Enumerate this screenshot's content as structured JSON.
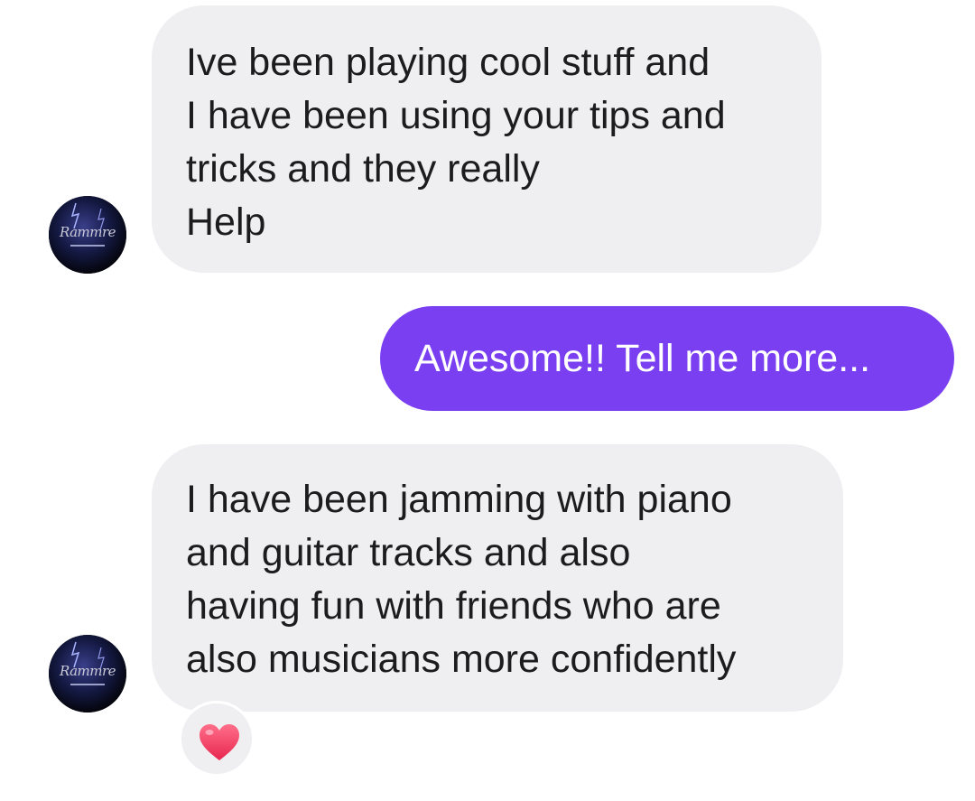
{
  "chat": {
    "messages": [
      {
        "direction": "incoming",
        "text": "Ive been playing cool stuff and\nI have been using your tips and\ntricks and they really\nHelp"
      },
      {
        "direction": "outgoing",
        "text": "Awesome!! Tell me more..."
      },
      {
        "direction": "incoming",
        "text": "I have been jamming with piano\nand guitar tracks and also\nhaving fun with friends who are\nalso musicians more confidently",
        "reaction": "heart-icon"
      }
    ],
    "avatar": {
      "logo_text": "Rammre"
    }
  },
  "colors": {
    "incoming_bubble": "#efeef1",
    "outgoing_bubble": "#7a3ff0",
    "outgoing_text": "#ffffff",
    "heart": "#f03a5f"
  }
}
